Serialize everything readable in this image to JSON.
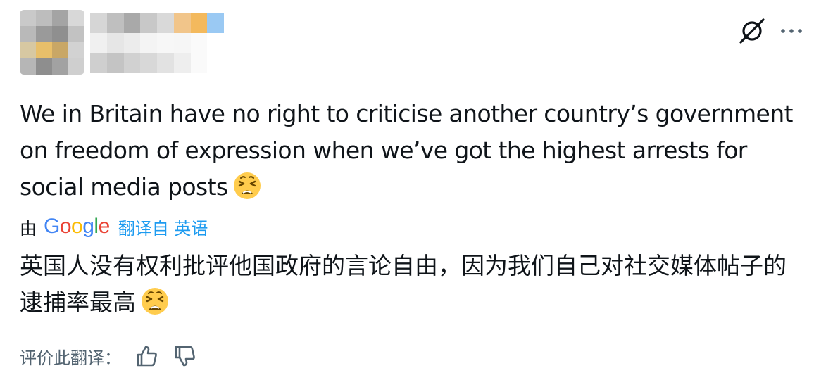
{
  "tweet": {
    "text": "We in Britain have no right to criticise another country’s government on freedom of expression when we’ve got the highest arrests for social media posts",
    "emoji": "weary-face-emoji"
  },
  "translation": {
    "by_label": "由",
    "provider": "Google",
    "link_label": "翻译自 英语",
    "translated_text": "英国人没有权利批评他国政府的言论自由，因为我们自己对社交媒体帖子的逮捕率最高",
    "rate_label": "评价此翻译："
  },
  "icons": {
    "grok": "grok-icon",
    "more": "more-dots-icon",
    "thumb_up": "thumb-up-icon",
    "thumb_down": "thumb-down-icon"
  },
  "colors": {
    "text": "#0f1419",
    "link": "#1d9bf0",
    "muted": "#536471",
    "google_blue": "#4285F4",
    "google_red": "#EA4335",
    "google_yellow": "#FBBC05",
    "google_green": "#34A853"
  }
}
